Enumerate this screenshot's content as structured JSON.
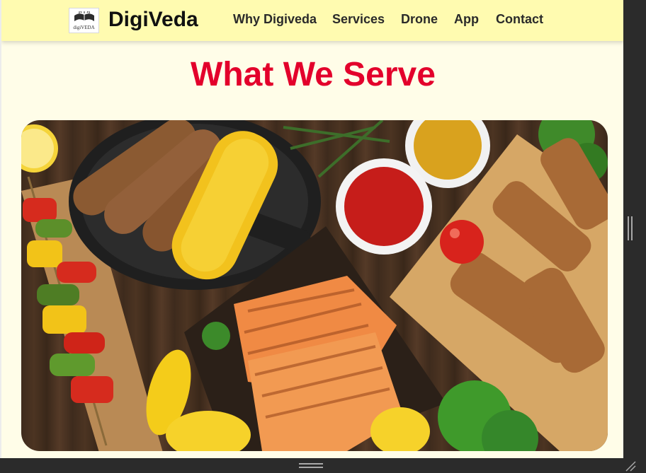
{
  "brand": {
    "logo_caption": "digiVEDA",
    "name": "DigiVeda"
  },
  "nav": {
    "items": [
      {
        "label": "Why Digiveda"
      },
      {
        "label": "Services"
      },
      {
        "label": "Drone"
      },
      {
        "label": "App"
      },
      {
        "label": "Contact"
      }
    ]
  },
  "section": {
    "heading": "What We Serve"
  },
  "hero_image": {
    "subject": "grilled food spread",
    "icon": "food-photo"
  },
  "colors": {
    "nav_background": "#fffbb0",
    "page_background": "#fffde8",
    "heading": "#e3002b"
  }
}
